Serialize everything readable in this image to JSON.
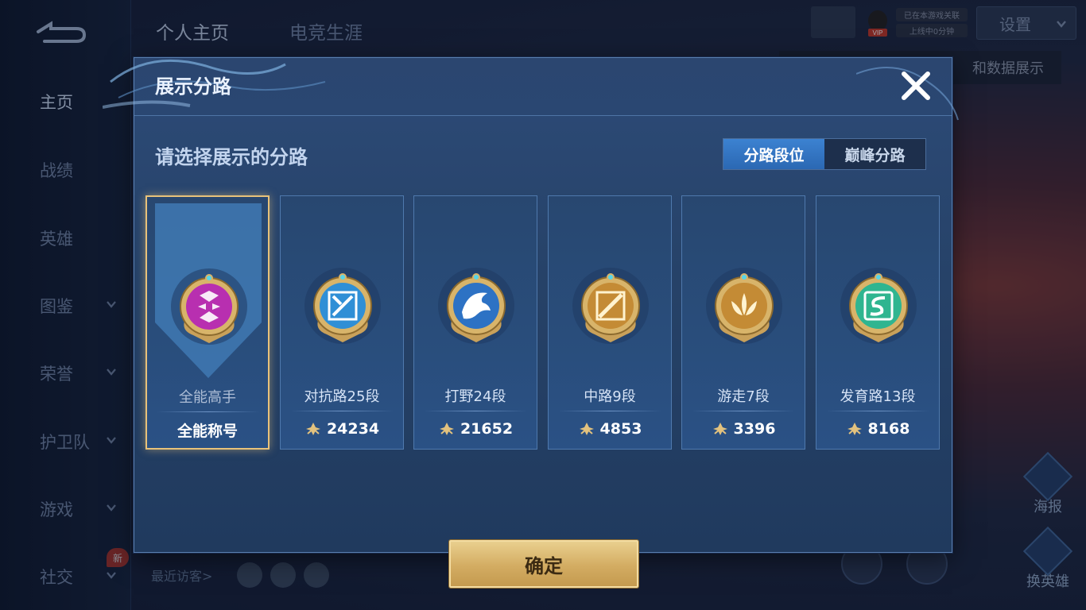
{
  "sidebar": {
    "items": [
      {
        "label": "主页",
        "has_chevron": false,
        "active": true
      },
      {
        "label": "战绩",
        "has_chevron": false,
        "active": false
      },
      {
        "label": "英雄",
        "has_chevron": false,
        "active": false
      },
      {
        "label": "图鉴",
        "has_chevron": true,
        "active": false
      },
      {
        "label": "荣誉",
        "has_chevron": true,
        "active": false
      },
      {
        "label": "护卫队",
        "has_chevron": true,
        "active": false
      },
      {
        "label": "游戏",
        "has_chevron": true,
        "active": false
      },
      {
        "label": "社交",
        "has_chevron": true,
        "active": false
      }
    ],
    "new_badge": "新"
  },
  "top_tabs": [
    "个人主页",
    "电竞生涯"
  ],
  "top_right": {
    "status_line1": "已在本游戏关联",
    "status_line2": "上线中0分钟",
    "settings_label": "设置",
    "tooltip_text": "和数据展示",
    "vip_label": "VIP"
  },
  "visitors_label": "最近访客>",
  "side_actions": [
    "海报",
    "换英雄"
  ],
  "modal": {
    "title": "展示分路",
    "subtitle": "请选择展示的分路",
    "segments": [
      {
        "label": "分路段位",
        "active": true
      },
      {
        "label": "巅峰分路",
        "active": false
      }
    ],
    "cards": [
      {
        "name": "全能高手",
        "sub": "全能称号",
        "points": null,
        "selected": true,
        "badge": "all-round",
        "color": "#b82fb0"
      },
      {
        "name": "对抗路25段",
        "sub": null,
        "points": "24234",
        "selected": false,
        "badge": "clash-lane",
        "color": "#2f8fd6"
      },
      {
        "name": "打野24段",
        "sub": null,
        "points": "21652",
        "selected": false,
        "badge": "jungle",
        "color": "#2d72c4"
      },
      {
        "name": "中路9段",
        "sub": null,
        "points": "4853",
        "selected": false,
        "badge": "mid-lane",
        "color": "#c48b35"
      },
      {
        "name": "游走7段",
        "sub": null,
        "points": "3396",
        "selected": false,
        "badge": "roam",
        "color": "#c48b35"
      },
      {
        "name": "发育路13段",
        "sub": null,
        "points": "8168",
        "selected": false,
        "badge": "farm-lane",
        "color": "#2fb590"
      }
    ],
    "confirm_label": "确定"
  }
}
